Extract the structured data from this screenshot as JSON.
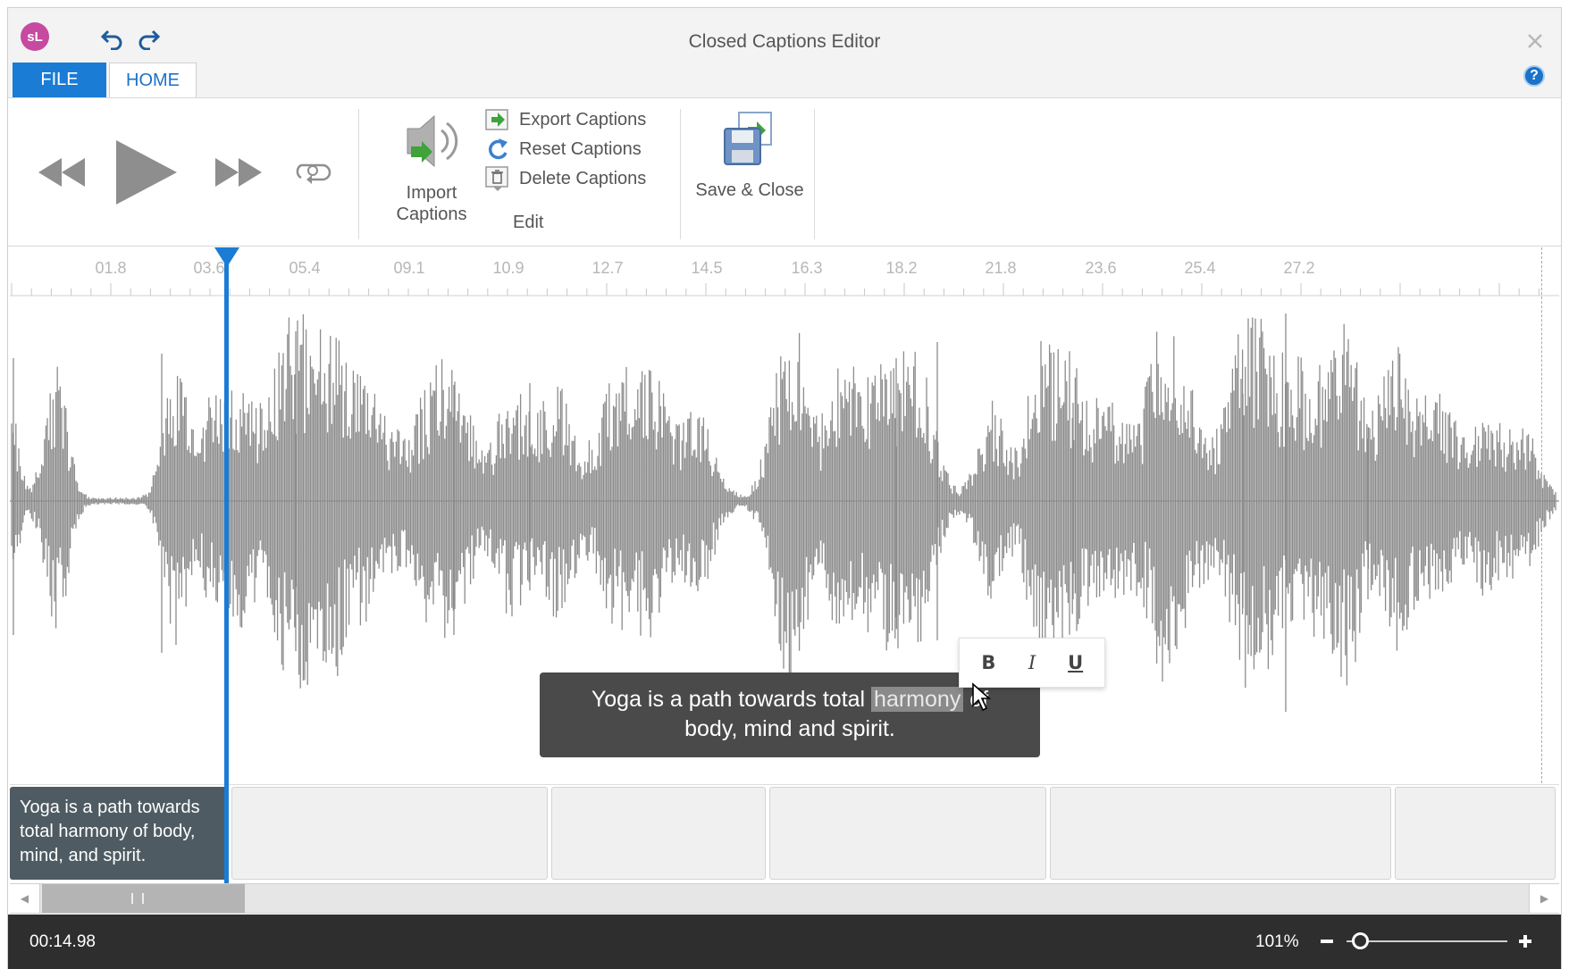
{
  "window": {
    "title": "Closed Captions Editor",
    "logo_text": "sL"
  },
  "tabs": [
    {
      "label": "FILE",
      "active": false
    },
    {
      "label": "HOME",
      "active": true
    }
  ],
  "ribbon": {
    "import_captions": {
      "label_line1": "Import",
      "label_line2": "Captions"
    },
    "edit_group": {
      "label": "Edit",
      "items": [
        {
          "label": "Export Captions",
          "icon": "export-icon"
        },
        {
          "label": "Reset Captions",
          "icon": "reset-icon"
        },
        {
          "label": "Delete Captions",
          "icon": "delete-icon"
        }
      ]
    },
    "save_close": {
      "label": "Save & Close"
    }
  },
  "timeline": {
    "tick_labels": [
      "01.8",
      "03.6",
      "05.4",
      "09.1",
      "10.9",
      "12.7",
      "14.5",
      "16.3",
      "18.2",
      "21.8",
      "23.6",
      "25.4",
      "27.2"
    ]
  },
  "caption_preview": {
    "before": "Yoga is a path towards total ",
    "highlighted": "harmony",
    "after": " of",
    "line2": "body, mind and spirit."
  },
  "format_toolbar": {
    "bold": "B",
    "italic": "I",
    "underline": "U"
  },
  "caption_track": {
    "active_caption": "Yoga is a path towards total harmony of body, mind, and spirit."
  },
  "status": {
    "time": "00:14.98",
    "zoom": "101%"
  },
  "colors": {
    "accent": "#1a7cd4",
    "waveform": "#8c8c8c",
    "status_bar": "#2e2e2e"
  }
}
